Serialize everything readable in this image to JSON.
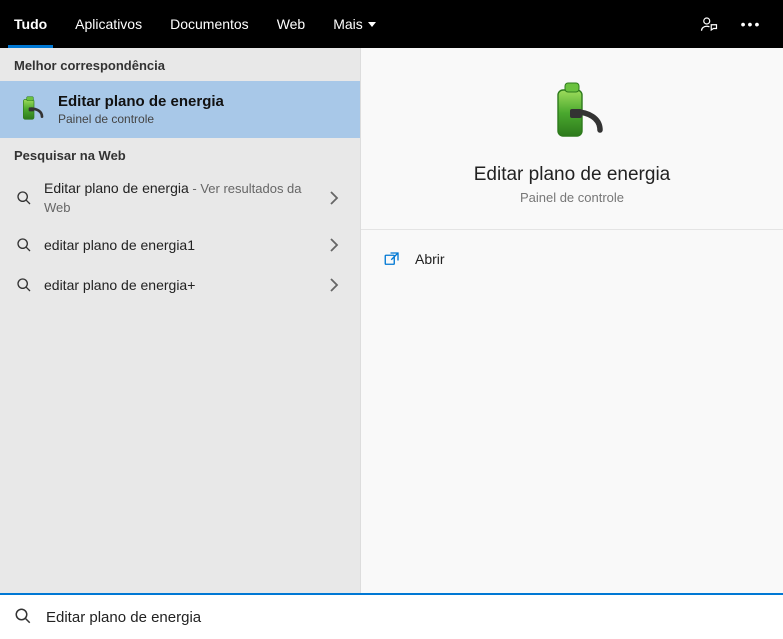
{
  "tabs": {
    "tudo": "Tudo",
    "aplicativos": "Aplicativos",
    "documentos": "Documentos",
    "web": "Web",
    "mais": "Mais"
  },
  "left": {
    "bestMatchHeader": "Melhor correspondência",
    "bestMatch": {
      "title": "Editar plano de energia",
      "subtitle": "Painel de controle"
    },
    "webHeader": "Pesquisar na Web",
    "webResults": [
      {
        "title": "Editar plano de energia",
        "suffix": " - Ver resultados da Web"
      },
      {
        "title": "editar plano de energia1",
        "suffix": ""
      },
      {
        "title": "editar plano de energia+",
        "suffix": ""
      }
    ]
  },
  "detail": {
    "title": "Editar plano de energia",
    "subtitle": "Painel de controle",
    "openLabel": "Abrir"
  },
  "search": {
    "value": "Editar plano de energia"
  },
  "colors": {
    "accent": "#0078d4",
    "bestMatchBg": "#a8c8e8"
  }
}
